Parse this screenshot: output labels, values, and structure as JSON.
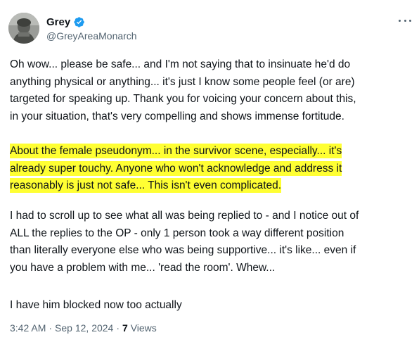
{
  "author": {
    "display_name": "Grey",
    "handle": "@GreyAreaMonarch",
    "verified": true,
    "verified_color": "#1d9bf0"
  },
  "menu_icon": "more-horizontal-icon",
  "paragraphs": [
    {
      "highlighted": false,
      "lines": [
        "Oh wow... please be safe... and I'm not saying that to insinuate he'd do",
        "anything physical or anything... it's just I know some people feel (or are)",
        "targeted for speaking up. Thank you for voicing your concern about this,",
        "in your situation, that's very compelling and shows immense fortitude."
      ]
    },
    {
      "highlighted": true,
      "highlight_color": "#ffff33",
      "lines": [
        "About the female pseudonym... in the survivor scene, especially... it's",
        "already super touchy. Anyone who won't acknowledge and address it",
        "reasonably is just not safe... This isn't even complicated."
      ]
    },
    {
      "highlighted": false,
      "lines": [
        "I had to scroll up to see what all was being replied to - and I notice out of",
        "ALL the replies to the OP - only 1 person took a way different position",
        "than literally everyone else who was being supportive... it's like... even if",
        "you have a problem with me... 'read the room'. Whew..."
      ]
    },
    {
      "highlighted": false,
      "lines": [
        "I have him blocked now too actually"
      ]
    }
  ],
  "meta": {
    "time": "3:42 AM",
    "separator": "·",
    "date": "Sep 12, 2024",
    "views_count": "7",
    "views_label": "Views"
  }
}
